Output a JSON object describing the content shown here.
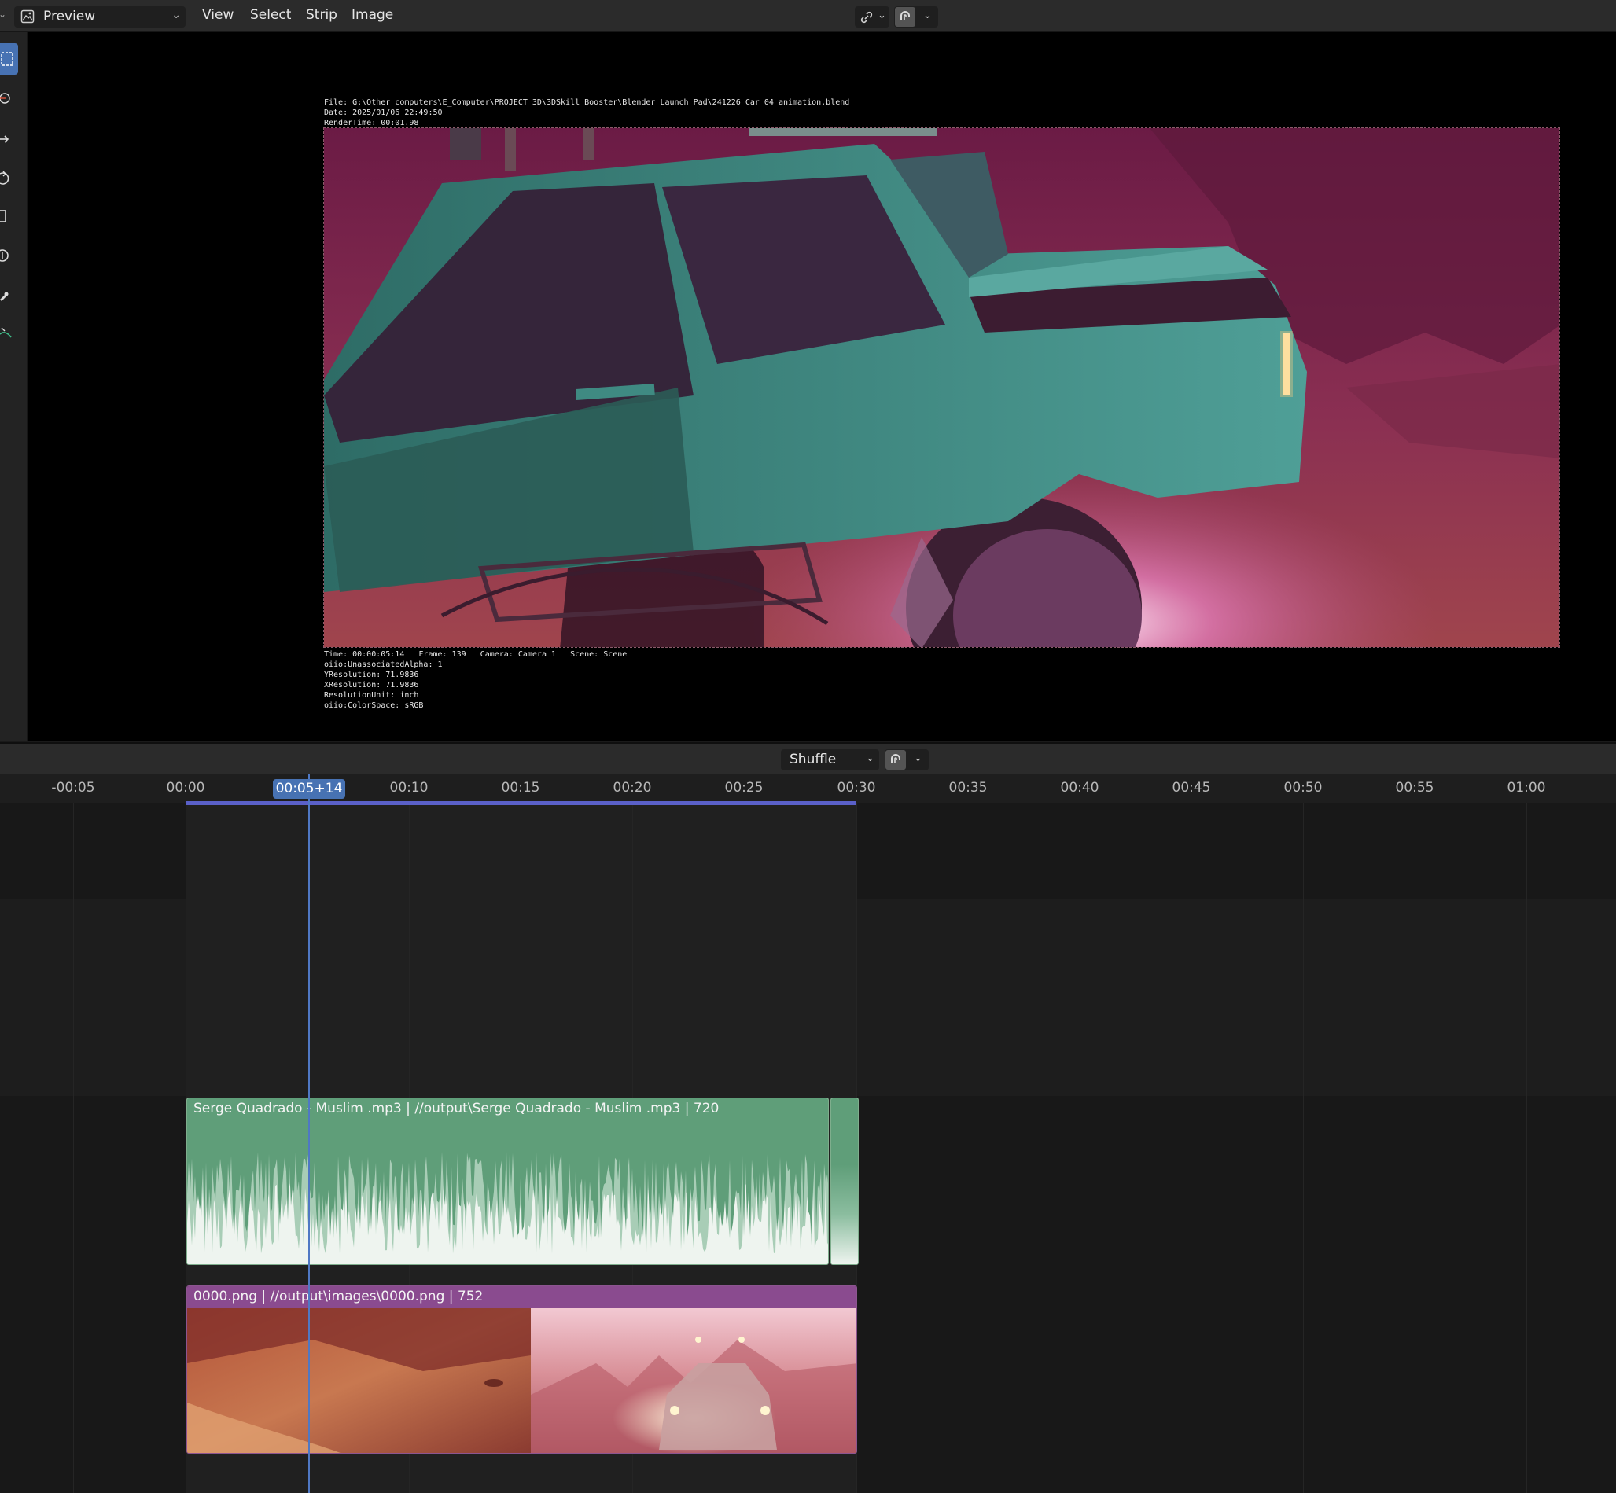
{
  "header": {
    "editor_type": "Preview",
    "menus": [
      "View",
      "Select",
      "Strip",
      "Image"
    ],
    "icons": [
      "image-editor-icon",
      "link-icon",
      "snap-magnet-icon"
    ]
  },
  "toolbar": {
    "tools": [
      "select-box-icon",
      "cursor-icon",
      "move-icon",
      "rotate-icon",
      "scale-icon",
      "transform-icon",
      "sample-icon",
      "annotate-icon"
    ]
  },
  "preview": {
    "metadata_top": [
      "File: G:\\Other computers\\E_Computer\\PROJECT 3D\\3DSkill Booster\\Blender Launch Pad\\241226 Car 04 animation.blend",
      "Date: 2025/01/06 22:49:50",
      "RenderTime: 00:01.98"
    ],
    "metadata_bottom": [
      "Time: 00:00:05:14   Frame: 139   Camera: Camera 1   Scene: Scene",
      "oiio:UnassociatedAlpha: 1",
      "YResolution: 71.9836",
      "XResolution: 71.9836",
      "ResolutionUnit: inch",
      "oiio:ColorSpace: sRGB"
    ]
  },
  "timeline": {
    "overlap_mode": "Shuffle",
    "playhead": "00:05+14",
    "ticks": [
      "-00:05",
      "00:00",
      "00:10",
      "00:15",
      "00:20",
      "00:25",
      "00:30",
      "00:35",
      "00:40",
      "00:45",
      "00:50",
      "00:55",
      "01:00"
    ],
    "audio_strip": "Serge Quadrado - Muslim .mp3 | //output\\Serge Quadrado - Muslim .mp3 | 720",
    "image_strip": "0000.png | //output\\images\\0000.png | 752"
  },
  "colors": {
    "accent": "#4772b3",
    "audio_strip": "#5f9e79",
    "image_strip": "#8a4b8f",
    "range": "#5a60c8"
  }
}
